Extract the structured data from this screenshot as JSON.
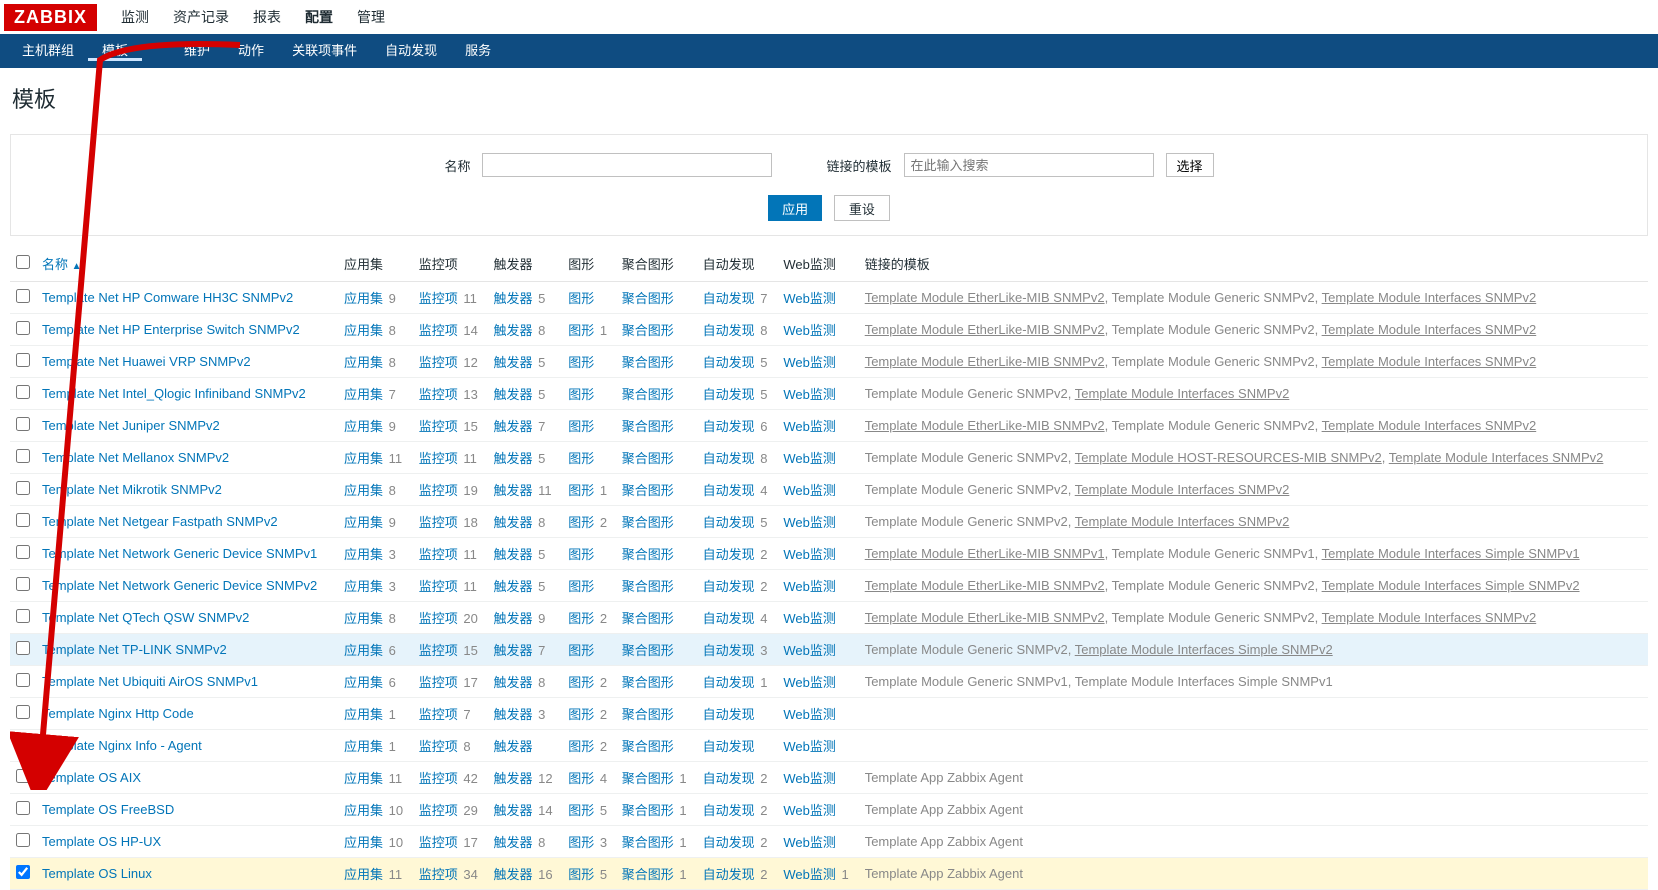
{
  "logo": "ZABBIX",
  "topnav": [
    "监测",
    "资产记录",
    "报表",
    "配置",
    "管理"
  ],
  "topnav_active": 3,
  "subnav": [
    "主机群组",
    "模板",
    "",
    "维护",
    "动作",
    "关联项事件",
    "自动发现",
    "服务"
  ],
  "subnav_active": 1,
  "page_title": "模板",
  "filter": {
    "name_label": "名称",
    "linked_label": "链接的模板",
    "linked_placeholder": "在此输入搜索",
    "select_btn": "选择",
    "apply_btn": "应用",
    "reset_btn": "重设"
  },
  "columns": {
    "name": "名称",
    "app": "应用集",
    "item": "监控项",
    "trig": "触发器",
    "graph": "图形",
    "screen": "聚合图形",
    "disc": "自动发现",
    "web": "Web监测",
    "linked": "链接的模板"
  },
  "label": {
    "app": "应用集",
    "item": "监控项",
    "trig": "触发器",
    "graph": "图形",
    "screen": "聚合图形",
    "disc": "自动发现",
    "web": "Web监测"
  },
  "rows": [
    {
      "name": "Template Net HP Comware HH3C SNMPv2",
      "app": 9,
      "item": 11,
      "trig": 5,
      "graph": "",
      "screen": "",
      "disc": 7,
      "web": "",
      "linked": [
        "Template Module EtherLike-MIB SNMPv2",
        "Template Module Generic SNMPv2",
        "Template Module Interfaces SNMPv2"
      ],
      "ul": [
        0,
        2
      ]
    },
    {
      "name": "Template Net HP Enterprise Switch SNMPv2",
      "app": 8,
      "item": 14,
      "trig": 8,
      "graph": 1,
      "screen": "",
      "disc": 8,
      "web": "",
      "linked": [
        "Template Module EtherLike-MIB SNMPv2",
        "Template Module Generic SNMPv2",
        "Template Module Interfaces SNMPv2"
      ],
      "ul": [
        0,
        2
      ]
    },
    {
      "name": "Template Net Huawei VRP SNMPv2",
      "app": 8,
      "item": 12,
      "trig": 5,
      "graph": "",
      "screen": "",
      "disc": 5,
      "web": "",
      "linked": [
        "Template Module EtherLike-MIB SNMPv2",
        "Template Module Generic SNMPv2",
        "Template Module Interfaces SNMPv2"
      ],
      "ul": [
        0,
        2
      ]
    },
    {
      "name": "Template Net Intel_Qlogic Infiniband SNMPv2",
      "app": 7,
      "item": 13,
      "trig": 5,
      "graph": "",
      "screen": "",
      "disc": 5,
      "web": "",
      "linked": [
        "Template Module Generic SNMPv2",
        "Template Module Interfaces SNMPv2"
      ],
      "ul": [
        1
      ]
    },
    {
      "name": "Template Net Juniper SNMPv2",
      "app": 9,
      "item": 15,
      "trig": 7,
      "graph": "",
      "screen": "",
      "disc": 6,
      "web": "",
      "linked": [
        "Template Module EtherLike-MIB SNMPv2",
        "Template Module Generic SNMPv2",
        "Template Module Interfaces SNMPv2"
      ],
      "ul": [
        0,
        2
      ]
    },
    {
      "name": "Template Net Mellanox SNMPv2",
      "app": 11,
      "item": 11,
      "trig": 5,
      "graph": "",
      "screen": "",
      "disc": 8,
      "web": "",
      "linked": [
        "Template Module Generic SNMPv2",
        "Template Module HOST-RESOURCES-MIB SNMPv2",
        "Template Module Interfaces SNMPv2"
      ],
      "ul": [
        1,
        2
      ]
    },
    {
      "name": "Template Net Mikrotik SNMPv2",
      "app": 8,
      "item": 19,
      "trig": 11,
      "graph": 1,
      "screen": "",
      "disc": 4,
      "web": "",
      "linked": [
        "Template Module Generic SNMPv2",
        "Template Module Interfaces SNMPv2"
      ],
      "ul": [
        1
      ]
    },
    {
      "name": "Template Net Netgear Fastpath SNMPv2",
      "app": 9,
      "item": 18,
      "trig": 8,
      "graph": 2,
      "screen": "",
      "disc": 5,
      "web": "",
      "linked": [
        "Template Module Generic SNMPv2",
        "Template Module Interfaces SNMPv2"
      ],
      "ul": [
        1
      ]
    },
    {
      "name": "Template Net Network Generic Device SNMPv1",
      "app": 3,
      "item": 11,
      "trig": 5,
      "graph": "",
      "screen": "",
      "disc": 2,
      "web": "",
      "linked": [
        "Template Module EtherLike-MIB SNMPv1",
        "Template Module Generic SNMPv1",
        "Template Module Interfaces Simple SNMPv1"
      ],
      "ul": [
        0,
        2
      ]
    },
    {
      "name": "Template Net Network Generic Device SNMPv2",
      "app": 3,
      "item": 11,
      "trig": 5,
      "graph": "",
      "screen": "",
      "disc": 2,
      "web": "",
      "linked": [
        "Template Module EtherLike-MIB SNMPv2",
        "Template Module Generic SNMPv2",
        "Template Module Interfaces Simple SNMPv2"
      ],
      "ul": [
        0,
        2
      ]
    },
    {
      "name": "Template Net QTech QSW SNMPv2",
      "app": 8,
      "item": 20,
      "trig": 9,
      "graph": 2,
      "screen": "",
      "disc": 4,
      "web": "",
      "linked": [
        "Template Module EtherLike-MIB SNMPv2",
        "Template Module Generic SNMPv2",
        "Template Module Interfaces SNMPv2"
      ],
      "ul": [
        0,
        2
      ]
    },
    {
      "name": "Template Net TP-LINK SNMPv2",
      "app": 6,
      "item": 15,
      "trig": 7,
      "graph": "",
      "screen": "",
      "disc": 3,
      "web": "",
      "linked": [
        "Template Module Generic SNMPv2",
        "Template Module Interfaces Simple SNMPv2"
      ],
      "ul": [
        1
      ],
      "hover": true
    },
    {
      "name": "Template Net Ubiquiti AirOS SNMPv1",
      "app": 6,
      "item": 17,
      "trig": 8,
      "graph": 2,
      "screen": "",
      "disc": 1,
      "web": "",
      "linked": [
        "Template Module Generic SNMPv1",
        "Template Module Interfaces Simple SNMPv1"
      ],
      "ul": []
    },
    {
      "name": "Template Nginx Http Code",
      "app": 1,
      "item": 7,
      "trig": 3,
      "graph": 2,
      "screen": "",
      "disc": "",
      "web": "",
      "linked": [],
      "ul": []
    },
    {
      "name": "Template Nginx Info - Agent",
      "app": 1,
      "item": 8,
      "trig": "",
      "graph": 2,
      "screen": "",
      "disc": "",
      "web": "",
      "linked": [],
      "ul": []
    },
    {
      "name": "Template OS AIX",
      "app": 11,
      "item": 42,
      "trig": 12,
      "graph": 4,
      "screen": 1,
      "disc": 2,
      "web": "",
      "linked": [
        "Template App Zabbix Agent"
      ],
      "ul": []
    },
    {
      "name": "Template OS FreeBSD",
      "app": 10,
      "item": 29,
      "trig": 14,
      "graph": 5,
      "screen": 1,
      "disc": 2,
      "web": "",
      "linked": [
        "Template App Zabbix Agent"
      ],
      "ul": []
    },
    {
      "name": "Template OS HP-UX",
      "app": 10,
      "item": 17,
      "trig": 8,
      "graph": 3,
      "screen": 1,
      "disc": 2,
      "web": "",
      "linked": [
        "Template App Zabbix Agent"
      ],
      "ul": []
    },
    {
      "name": "Template OS Linux",
      "app": 11,
      "item": 34,
      "trig": 16,
      "graph": 5,
      "screen": 1,
      "disc": 2,
      "web": 1,
      "linked": [
        "Template App Zabbix Agent"
      ],
      "ul": [],
      "checked": true,
      "highlight": true
    }
  ]
}
